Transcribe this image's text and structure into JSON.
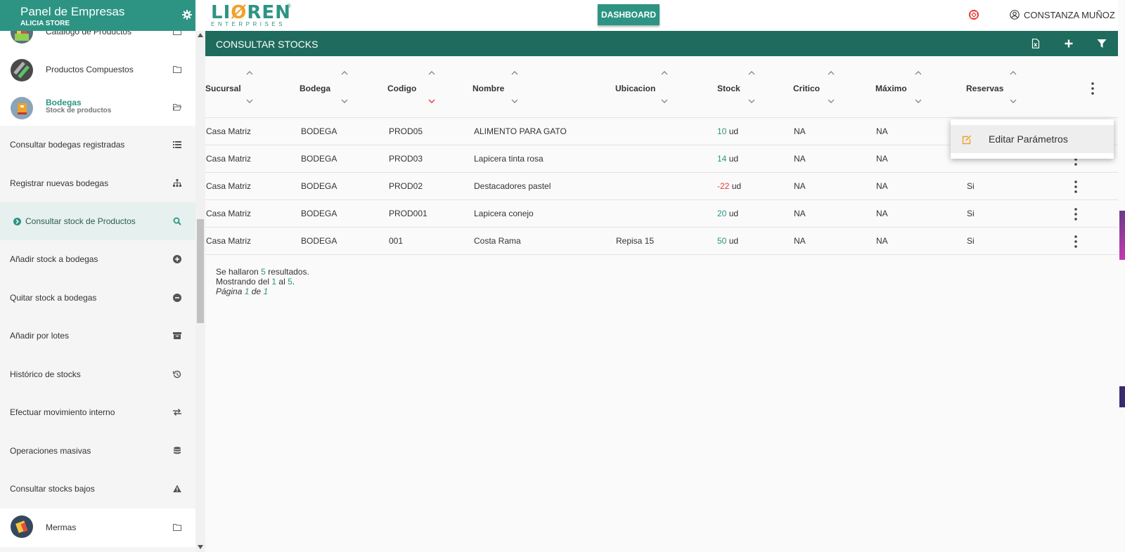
{
  "sidebar": {
    "title": "Panel de Empresas",
    "store": "ALICIA STORE",
    "modules": {
      "catalogo": {
        "label": "Catálogo de Productos"
      },
      "compuestos": {
        "label": "Productos Compuestos"
      },
      "bodegas": {
        "label": "Bodegas",
        "sub": "Stock de productos"
      },
      "mermas": {
        "label": "Mermas"
      }
    },
    "items": [
      {
        "label": "Consultar bodegas registradas",
        "icon": "list-icon"
      },
      {
        "label": "Registrar nuevas bodegas",
        "icon": "sitemap-icon"
      },
      {
        "label": "Consultar stock de Productos",
        "icon": "search-icon",
        "active": true
      },
      {
        "label": "Añadir stock a bodegas",
        "icon": "plus-circle-icon"
      },
      {
        "label": "Quitar stock a bodegas",
        "icon": "minus-circle-icon"
      },
      {
        "label": "Añadir por lotes",
        "icon": "archive-icon"
      },
      {
        "label": "Histórico de stocks",
        "icon": "history-icon"
      },
      {
        "label": "Efectuar movimiento interno",
        "icon": "exchange-icon"
      },
      {
        "label": "Operaciones masivas",
        "icon": "database-icon"
      },
      {
        "label": "Consultar stocks bajos",
        "icon": "warning-icon"
      }
    ]
  },
  "topbar": {
    "logo_text_a": "LI",
    "logo_text_o": "Ø",
    "logo_text_b": "REN",
    "logo_reg": "®",
    "logo_sub": "ENTERPRISES",
    "dashboard_label": "DASHBOARD",
    "user_name": "CONSTANZA MUÑOZ"
  },
  "panel": {
    "title": "CONSULTAR STOCKS"
  },
  "table": {
    "headers": {
      "sucursal": "Sucursal",
      "bodega": "Bodega",
      "codigo": "Codigo",
      "nombre": "Nombre",
      "ubicacion": "Ubicacion",
      "stock": "Stock",
      "critico": "Critico",
      "maximo": "Máximo",
      "reservas": "Reservas"
    },
    "rows": [
      {
        "sucursal": "Casa Matriz",
        "bodega": "BODEGA",
        "codigo": "PROD05",
        "nombre": "ALIMENTO PARA GATO",
        "ubicacion": "",
        "stock": "10",
        "unit": "ud",
        "critico": "NA",
        "maximo": "NA",
        "reservas": ""
      },
      {
        "sucursal": "Casa Matriz",
        "bodega": "BODEGA",
        "codigo": "PROD03",
        "nombre": "Lapicera tinta rosa",
        "ubicacion": "",
        "stock": "14",
        "unit": "ud",
        "critico": "NA",
        "maximo": "NA",
        "reservas": ""
      },
      {
        "sucursal": "Casa Matriz",
        "bodega": "BODEGA",
        "codigo": "PROD02",
        "nombre": "Destacadores pastel",
        "ubicacion": "",
        "stock": "-22",
        "unit": "ud",
        "critico": "NA",
        "maximo": "NA",
        "reservas": "Si"
      },
      {
        "sucursal": "Casa Matriz",
        "bodega": "BODEGA",
        "codigo": "PROD001",
        "nombre": "Lapicera conejo",
        "ubicacion": "",
        "stock": "20",
        "unit": "ud",
        "critico": "NA",
        "maximo": "NA",
        "reservas": "Si"
      },
      {
        "sucursal": "Casa Matriz",
        "bodega": "BODEGA",
        "codigo": "001",
        "nombre": "Costa Rama",
        "ubicacion": "Repisa 15",
        "stock": "50",
        "unit": "ud",
        "critico": "NA",
        "maximo": "NA",
        "reservas": "Si"
      }
    ]
  },
  "summary": {
    "found_pre": "Se hallaron",
    "found_count": "5",
    "found_post": "resultados.",
    "showing_pre": "Mostrando del",
    "showing_from": "1",
    "showing_mid": "al",
    "showing_to": "5",
    "showing_end": ".",
    "page_pre": "Página",
    "page_num": "1",
    "page_mid": "de",
    "page_total": "1"
  },
  "popup": {
    "label": "Editar Parámetros"
  },
  "colors": {
    "primary": "#2d9483",
    "header_dark": "#1f6b5d",
    "accent_orange": "#f0a12c",
    "negative": "#e53935"
  }
}
